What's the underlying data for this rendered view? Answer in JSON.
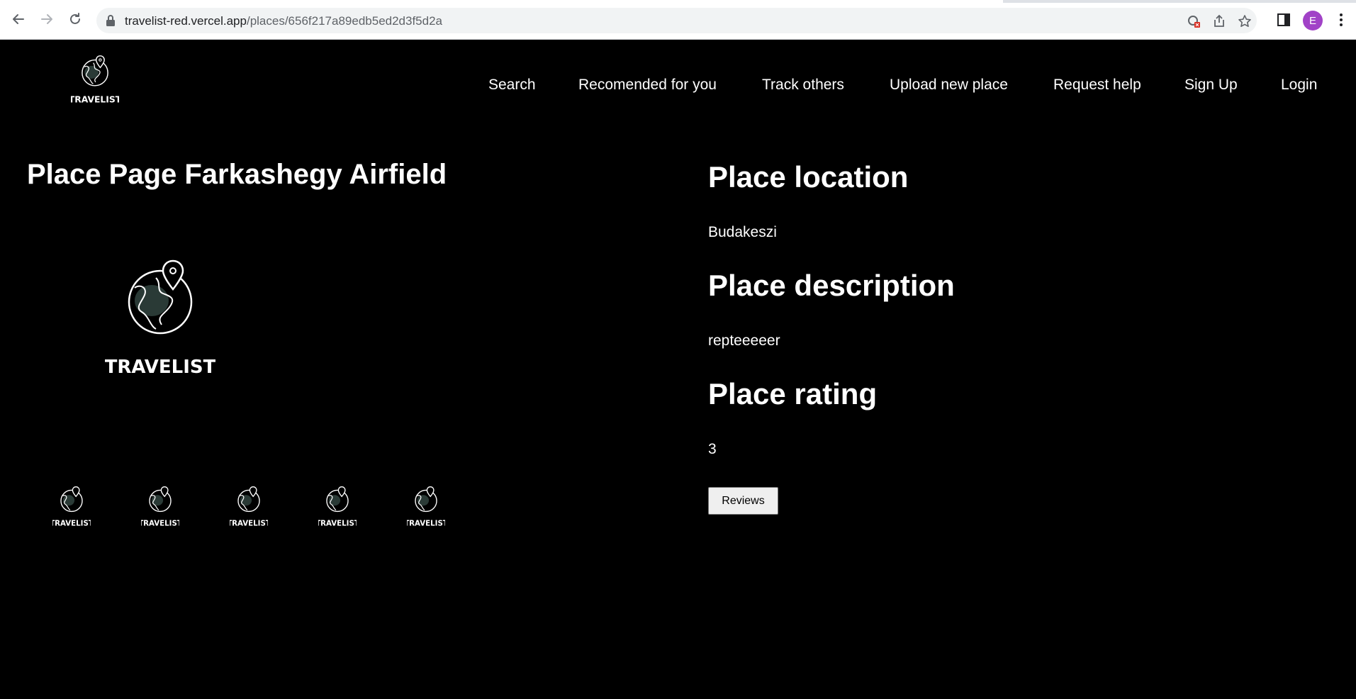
{
  "browser": {
    "url_host": "travelist-red.vercel.app",
    "url_path": "/places/656f217a89edb5ed2d3f5d2a",
    "avatar_letter": "E",
    "icons": [
      "back-icon",
      "forward-icon",
      "reload-icon",
      "lock-icon",
      "blocked-icon",
      "share-icon",
      "star-icon",
      "side-panel-icon",
      "menu-icon"
    ]
  },
  "site": {
    "logo_text": "TRAVELIST",
    "nav": [
      "Search",
      "Recomended for you",
      "Track others",
      "Upload new place",
      "Request help",
      "Sign Up",
      "Login"
    ]
  },
  "place": {
    "title": "Place Page Farkashegy Airfield",
    "location_heading": "Place location",
    "location": "Budakeszi",
    "description_heading": "Place description",
    "description": "repteeeeer",
    "rating_heading": "Place rating",
    "rating": "3",
    "reviews_button": "Reviews",
    "image_logo_text": "TRAVELIST",
    "thumbnails": [
      "TRAVELIST",
      "TRAVELIST",
      "TRAVELIST",
      "TRAVELIST",
      "TRAVELIST"
    ]
  },
  "colors": {
    "background": "#000000",
    "text": "#ffffff",
    "logo_fill": "#2a3a36",
    "avatar": "#a142c7"
  }
}
